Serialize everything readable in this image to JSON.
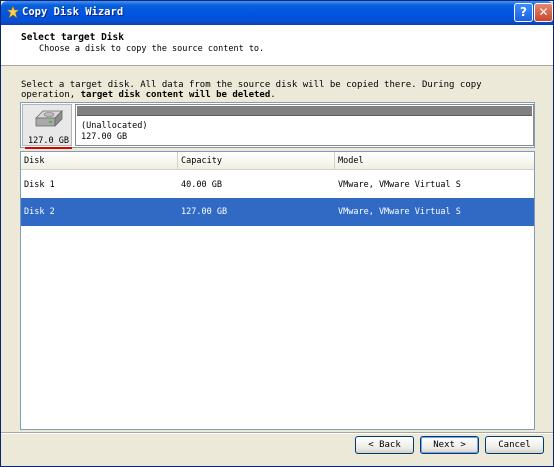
{
  "window": {
    "title": "Copy Disk Wizard",
    "help_glyph": "?",
    "close_glyph": "✕"
  },
  "header": {
    "title": "Select target Disk",
    "subtitle": "Choose a disk to copy the source content to."
  },
  "description": {
    "normal": "Select a target disk. All data from the source disk will be copied there. During copy operation, ",
    "bold": "target disk content will be deleted",
    "end": "."
  },
  "disk_map": {
    "disk_size": "127.0 GB",
    "partition_label": "(Unallocated)",
    "partition_size": "127.00 GB"
  },
  "table": {
    "columns": [
      "Disk",
      "Capacity",
      "Model"
    ],
    "rows": [
      {
        "disk": "Disk 1",
        "capacity": "40.00 GB",
        "model": "VMware, VMware Virtual S",
        "selected": false
      },
      {
        "disk": "Disk 2",
        "capacity": "127.00 GB",
        "model": "VMware, VMware Virtual S",
        "selected": true
      }
    ]
  },
  "buttons": {
    "back": "< Back",
    "next": "Next >",
    "cancel": "Cancel"
  },
  "colors": {
    "selection": "#316ac5",
    "titlebar": "#0054e3",
    "accent_underline": "#e00000"
  }
}
